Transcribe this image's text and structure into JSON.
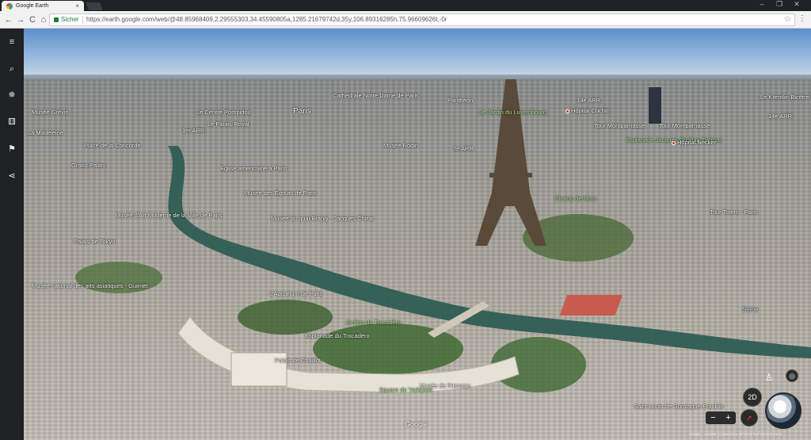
{
  "browser": {
    "tab_title": "Google Earth",
    "tab_close": "×",
    "back": "←",
    "forward": "→",
    "reload": "C",
    "home": "⌂",
    "secure_label": "Sicher",
    "url": "https://earth.google.com/web/@48.85968409,2.29555303,34.45590805a,1285.21679742d,35y,106.89316285h,75.96609626t,-0r",
    "bookmark_icon": "☆",
    "menu_icon": "⋮",
    "window_controls": [
      "–",
      "❐",
      "✕"
    ]
  },
  "rail": {
    "items": [
      {
        "icon": "menu-icon",
        "glyph": "≡"
      },
      {
        "icon": "search-icon",
        "glyph": "⌕"
      },
      {
        "icon": "voyager-icon",
        "glyph": "✵"
      },
      {
        "icon": "feeling-lucky-dice-icon",
        "glyph": "⚅"
      },
      {
        "icon": "bookmark-icon",
        "glyph": "⚑"
      },
      {
        "icon": "share-icon",
        "glyph": "⋖"
      }
    ]
  },
  "map": {
    "labels": [
      {
        "text": "Cathédrale Notre Dame de Paris",
        "kind": "white"
      },
      {
        "text": "Panthéon",
        "kind": "white"
      },
      {
        "text": "13e ARR.",
        "kind": "white"
      },
      {
        "text": "Le Kremlin-Bicêtre",
        "kind": "white"
      },
      {
        "text": "Musée Grévin",
        "kind": "white"
      },
      {
        "text": "Le Centre Pompidou",
        "kind": "white"
      },
      {
        "text": "Paris",
        "kind": "big"
      },
      {
        "text": "1er ARR.",
        "kind": "white"
      },
      {
        "text": "Le Palais-Royal",
        "kind": "white"
      },
      {
        "text": "Le Jardin du Luxembourg",
        "kind": "green"
      },
      {
        "text": "Hôpital Cochin",
        "kind": "red"
      },
      {
        "text": "14e ARR.",
        "kind": "white"
      },
      {
        "text": "La Madeleine",
        "kind": "white"
      },
      {
        "text": "Place de la Concorde",
        "kind": "white"
      },
      {
        "text": "Musée Rodin",
        "kind": "white"
      },
      {
        "text": "7e ARR.",
        "kind": "white"
      },
      {
        "text": "Tour Montparnasse",
        "kind": "white"
      },
      {
        "text": "Tour Montparnasse",
        "kind": "white"
      },
      {
        "text": "Esplanade Jacques Chaban-Delmas",
        "kind": "green"
      },
      {
        "text": "Hôpital Necker",
        "kind": "red"
      },
      {
        "text": "Grand Palais",
        "kind": "white"
      },
      {
        "text": "Église américaine à Paris",
        "kind": "white"
      },
      {
        "text": "Musée des Égouts de Paris",
        "kind": "white"
      },
      {
        "text": "Champ de Mars",
        "kind": "green"
      },
      {
        "text": "Musée d'Art Moderne de la Ville de Paris",
        "kind": "white"
      },
      {
        "text": "Musée du quai Branly - Jacques Chirac",
        "kind": "white"
      },
      {
        "text": "Tour Totem - Paris",
        "kind": "white"
      },
      {
        "text": "Palais de Tokyo",
        "kind": "white"
      },
      {
        "text": "Musée national des arts asiatiques - Guimet",
        "kind": "white"
      },
      {
        "text": "L'Aquarium de Paris",
        "kind": "white"
      },
      {
        "text": "Jardins du Trocadéro",
        "kind": "green"
      },
      {
        "text": "Seine",
        "kind": "seine"
      },
      {
        "text": "Esplanade du Trocadéro",
        "kind": "white"
      },
      {
        "text": "Palais de Chaillot",
        "kind": "white"
      },
      {
        "text": "Square de Yorktown",
        "kind": "green"
      },
      {
        "text": "Musée de l'Homme",
        "kind": "white"
      },
      {
        "text": "Saint-Louis de Gonzague-Franklin",
        "kind": "white"
      }
    ]
  },
  "controls": {
    "view_toggle": "2D",
    "zoom_out": "−",
    "zoom_in": "+",
    "pegman_icon": "pegman-icon",
    "my_location_icon": "my-location-icon",
    "compass_icon": "compass-icon",
    "globe_icon": "globe-icon"
  },
  "footer": {
    "watermark": "Google",
    "attribution": "Google · Landsat / Copernicus   48°51'31\"N 2°18'45\"E  54 m"
  },
  "colors": {
    "rail_bg": "#202124",
    "chrome_bg": "#f2f2f2",
    "secure_green": "#1a7f37",
    "river": "#2f5d54",
    "sky": "#5d8ecb"
  }
}
